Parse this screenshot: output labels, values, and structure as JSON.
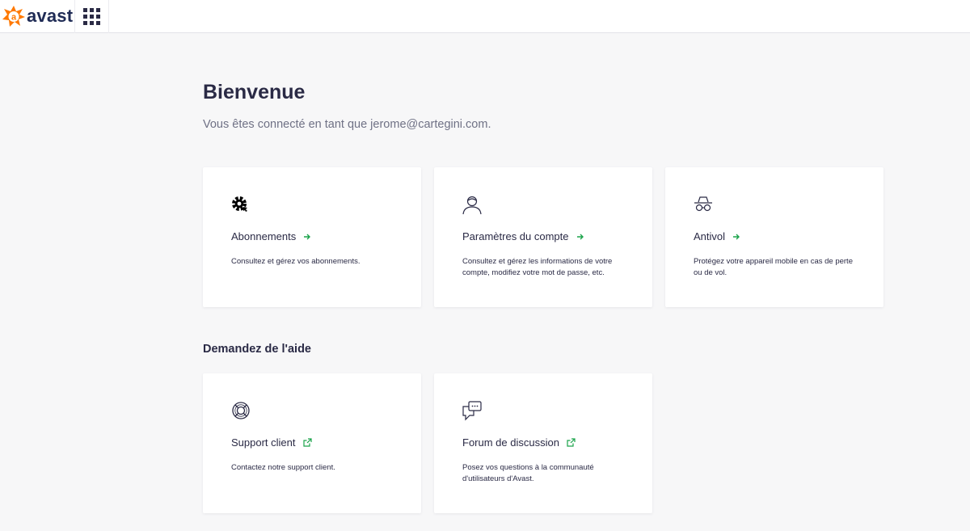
{
  "header": {
    "brand": "avast",
    "brand_icon": "avast-logo-icon",
    "apps_icon": "apps-grid-icon"
  },
  "main": {
    "title": "Bienvenue",
    "subtitle": "Vous êtes connecté en tant que jerome@cartegini.com."
  },
  "cards": [
    {
      "icon": "gear-icon",
      "title": "Abonnements",
      "description": "Consultez et gérez vos abonnements."
    },
    {
      "icon": "user-icon",
      "title": "Paramètres du compte",
      "description": "Consultez et gérez les informations de votre compte, modifiez votre mot de passe, etc."
    },
    {
      "icon": "spy-icon",
      "title": "Antivol",
      "description": "Protégez votre appareil mobile en cas de perte ou de vol."
    }
  ],
  "help": {
    "title": "Demandez de l'aide",
    "cards": [
      {
        "icon": "lifebuoy-icon",
        "title": "Support client",
        "description": "Contactez notre support client."
      },
      {
        "icon": "chat-icon",
        "title": "Forum de discussion",
        "description": "Posez vos questions à la communauté d'utilisateurs d'Avast."
      }
    ]
  },
  "colors": {
    "accent": "#ff7800",
    "arrow": "#1aa34a",
    "text": "#2a2a45",
    "muted": "#6f7185"
  }
}
